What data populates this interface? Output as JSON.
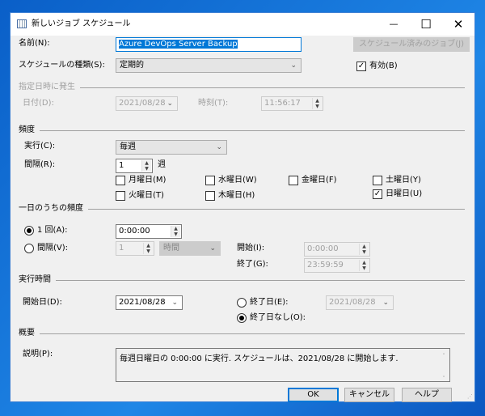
{
  "window": {
    "title": "新しいジョブ スケジュール",
    "minimize": "—",
    "maximize": "☐",
    "close": "✕"
  },
  "name": {
    "label": "名前(N):",
    "value": "Azure DevOps Server Backup",
    "scheduled_jobs_button": "スケジュール済みのジョブ(J)"
  },
  "schedule_type": {
    "label": "スケジュールの種類(S):",
    "value": "定期的",
    "enabled_label": "有効(B)",
    "enabled": true
  },
  "one_time": {
    "section": "指定日時に発生",
    "date_label": "日付(D):",
    "date": "2021/08/28",
    "time_label": "時刻(T):",
    "time": "11:56:17"
  },
  "frequency": {
    "section": "頻度",
    "occurs_label": "実行(C):",
    "occurs": "毎週",
    "interval_label": "間隔(R):",
    "interval": "1",
    "interval_unit": "週",
    "days": [
      {
        "label": "月曜日(M)",
        "checked": false
      },
      {
        "label": "水曜日(W)",
        "checked": false
      },
      {
        "label": "金曜日(F)",
        "checked": false
      },
      {
        "label": "土曜日(Y)",
        "checked": false
      },
      {
        "label": "火曜日(T)",
        "checked": false
      },
      {
        "label": "木曜日(H)",
        "checked": false
      },
      {
        "label": "日曜日(U)",
        "checked": true
      }
    ]
  },
  "daily": {
    "section": "一日のうちの頻度",
    "once_label": "1 回(A):",
    "once_time": "0:00:00",
    "every_label": "間隔(V):",
    "every_value": "1",
    "every_unit": "時間",
    "start_label": "開始(I):",
    "start": "0:00:00",
    "end_label": "終了(G):",
    "end": "23:59:59"
  },
  "duration": {
    "section": "実行時間",
    "start_label": "開始日(D):",
    "start": "2021/08/28",
    "end_date_label": "終了日(E):",
    "end_date": "2021/08/28",
    "no_end_label": "終了日なし(O):"
  },
  "summary": {
    "section": "概要",
    "description_label": "説明(P):",
    "description": "毎週日曜日の 0:00:00 に実行. スケジュールは、2021/08/28 に開始します."
  },
  "buttons": {
    "ok": "OK",
    "cancel": "キャンセル",
    "help": "ヘルプ"
  }
}
